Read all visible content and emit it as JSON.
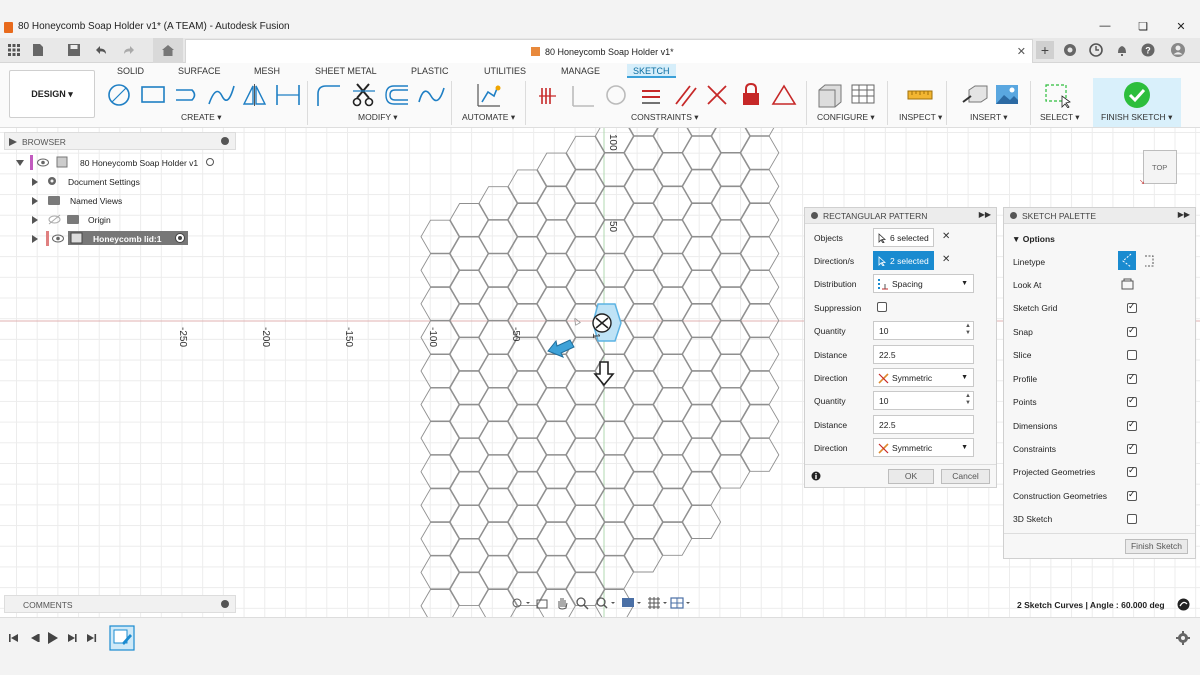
{
  "window": {
    "title": "80 Honeycomb Soap Holder v1* (A TEAM) - Autodesk Fusion"
  },
  "doc_tab": {
    "title": "80 Honeycomb Soap Holder v1*"
  },
  "toolbar": {
    "design_label": "DESIGN",
    "workspace_tabs": [
      "SOLID",
      "SURFACE",
      "MESH",
      "SHEET METAL",
      "PLASTIC",
      "UTILITIES",
      "MANAGE",
      "SKETCH"
    ],
    "active_tab": "SKETCH",
    "groups": [
      "CREATE",
      "MODIFY",
      "AUTOMATE",
      "CONSTRAINTS",
      "CONFIGURE",
      "INSPECT",
      "INSERT",
      "SELECT",
      "FINISH SKETCH"
    ]
  },
  "browser": {
    "header": "BROWSER",
    "items": [
      {
        "label": "80 Honeycomb Soap Holder v1"
      },
      {
        "label": "Document Settings"
      },
      {
        "label": "Named Views"
      },
      {
        "label": "Origin"
      },
      {
        "label": "Honeycomb lid:1"
      }
    ]
  },
  "axis_labels": {
    "h": [
      "-250",
      "-200",
      "-150",
      "-100",
      "-50"
    ],
    "v": [
      "100",
      "50"
    ],
    "origin_fragment": "1"
  },
  "rect_pattern": {
    "title": "RECTANGULAR PATTERN",
    "rows": [
      {
        "label": "Objects",
        "value": "6 selected"
      },
      {
        "label": "Direction/s",
        "value": "2 selected"
      },
      {
        "label": "Distribution",
        "value": "Spacing"
      },
      {
        "label": "Suppression",
        "value": ""
      },
      {
        "label": "Quantity",
        "value": "10"
      },
      {
        "label": "Distance",
        "value": "22.5"
      },
      {
        "label": "Direction",
        "value": "Symmetric"
      },
      {
        "label": "Quantity",
        "value": "10"
      },
      {
        "label": "Distance",
        "value": "22.5"
      },
      {
        "label": "Direction",
        "value": "Symmetric"
      }
    ],
    "ok": "OK",
    "cancel": "Cancel"
  },
  "sketch_palette": {
    "title": "SKETCH PALETTE",
    "section": "Options",
    "rows": [
      {
        "label": "Linetype",
        "checked": null
      },
      {
        "label": "Look At",
        "checked": null
      },
      {
        "label": "Sketch Grid",
        "checked": true
      },
      {
        "label": "Snap",
        "checked": true
      },
      {
        "label": "Slice",
        "checked": false
      },
      {
        "label": "Profile",
        "checked": true
      },
      {
        "label": "Points",
        "checked": true
      },
      {
        "label": "Dimensions",
        "checked": true
      },
      {
        "label": "Constraints",
        "checked": true
      },
      {
        "label": "Projected Geometries",
        "checked": true
      },
      {
        "label": "Construction Geometries",
        "checked": true
      },
      {
        "label": "3D Sketch",
        "checked": false
      }
    ],
    "finish_button": "Finish Sketch"
  },
  "viewcube": {
    "label": "TOP"
  },
  "comments": {
    "header": "COMMENTS"
  },
  "status": {
    "text": "2 Sketch Curves | Angle : 60.000 deg"
  },
  "colors": {
    "accent": "#1a8bd0",
    "finish_green": "#2dbe3c",
    "active_tab_bg": "#d6eefa"
  }
}
